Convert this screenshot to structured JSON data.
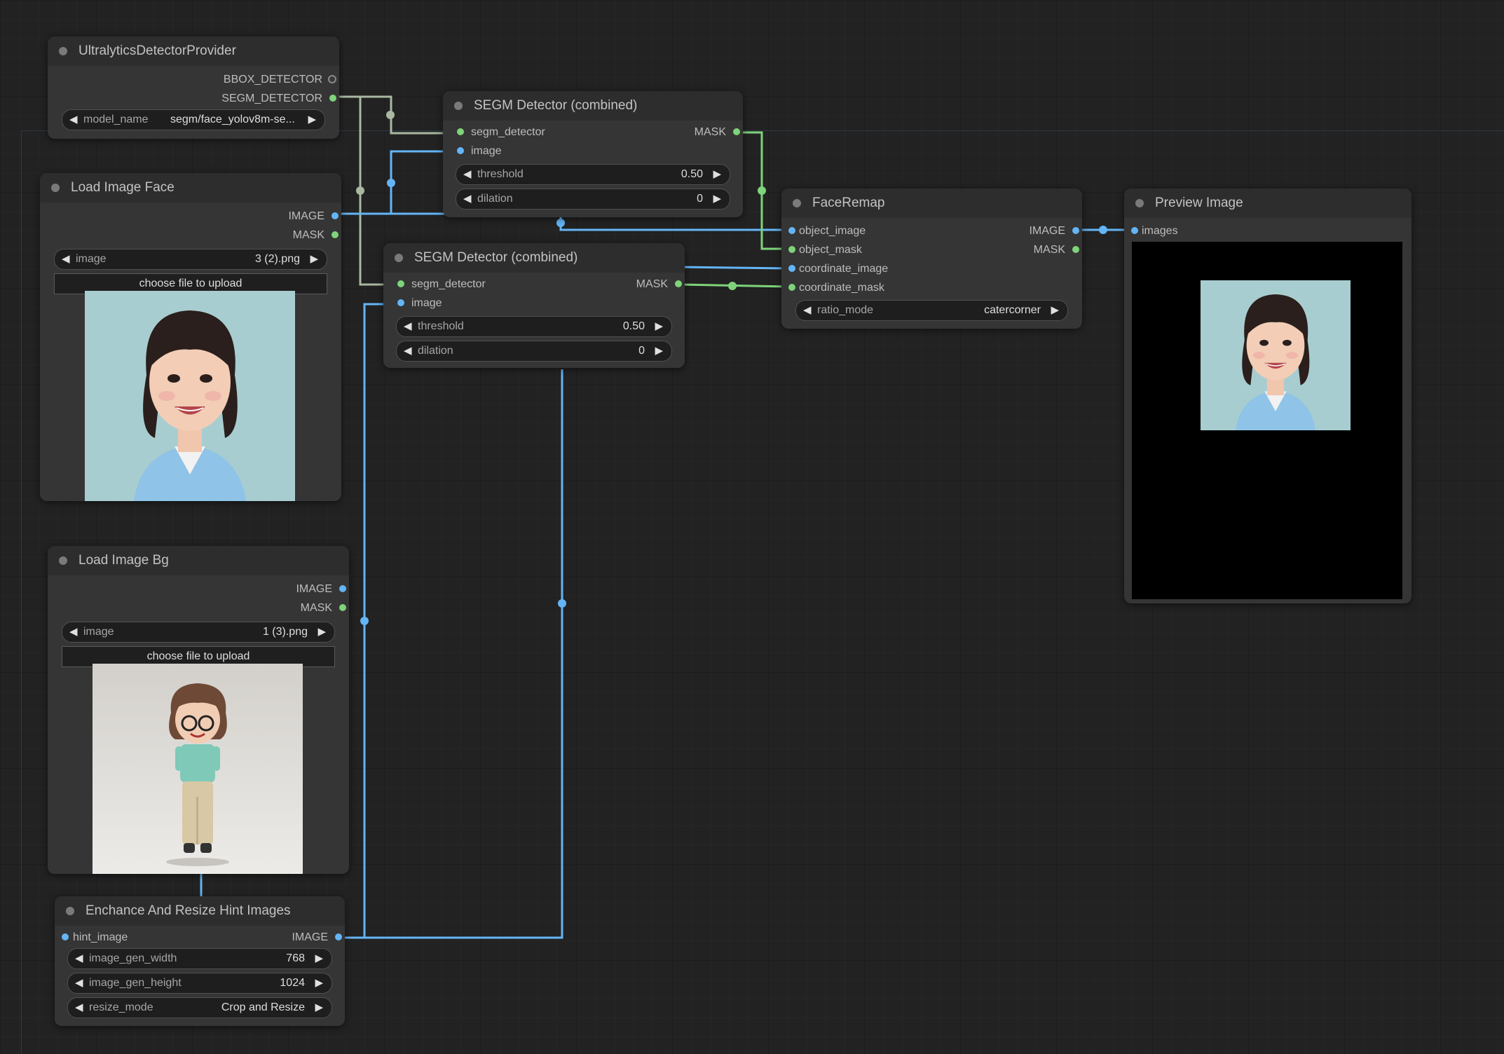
{
  "nodes": {
    "detector_provider": {
      "title": "UltralyticsDetectorProvider",
      "outputs": [
        "BBOX_DETECTOR",
        "SEGM_DETECTOR"
      ],
      "model_name": {
        "name": "model_name",
        "value": "segm/face_yolov8m-se..."
      }
    },
    "load_face": {
      "title": "Load Image Face",
      "outputs": [
        "IMAGE",
        "MASK"
      ],
      "image": {
        "name": "image",
        "value": "3 (2).png"
      },
      "upload_label": "choose file to upload"
    },
    "segm_top": {
      "title": "SEGM Detector (combined)",
      "inputs": [
        "segm_detector",
        "image"
      ],
      "output": "MASK",
      "threshold": {
        "name": "threshold",
        "value": "0.50"
      },
      "dilation": {
        "name": "dilation",
        "value": "0"
      }
    },
    "segm_bottom": {
      "title": "SEGM Detector (combined)",
      "inputs": [
        "segm_detector",
        "image"
      ],
      "output": "MASK",
      "threshold": {
        "name": "threshold",
        "value": "0.50"
      },
      "dilation": {
        "name": "dilation",
        "value": "0"
      }
    },
    "face_remap": {
      "title": "FaceRemap",
      "inputs": [
        "object_image",
        "object_mask",
        "coordinate_image",
        "coordinate_mask"
      ],
      "outputs": [
        "IMAGE",
        "MASK"
      ],
      "ratio_mode": {
        "name": "ratio_mode",
        "value": "catercorner"
      }
    },
    "preview": {
      "title": "Preview Image",
      "input": "images"
    },
    "load_bg": {
      "title": "Load Image Bg",
      "outputs": [
        "IMAGE",
        "MASK"
      ],
      "image": {
        "name": "image",
        "value": "1 (3).png"
      },
      "upload_label": "choose file to upload"
    },
    "enhance": {
      "title": "Enchance And Resize Hint Images",
      "input": "hint_image",
      "output": "IMAGE",
      "width": {
        "name": "image_gen_width",
        "value": "768"
      },
      "height": {
        "name": "image_gen_height",
        "value": "1024"
      },
      "resize_mode": {
        "name": "resize_mode",
        "value": "Crop and Resize"
      }
    }
  },
  "colors": {
    "image_link": "#64b5f6",
    "mask_link": "#7ed47a",
    "detector_link": "#a9b8a0",
    "node_bg": "#353535",
    "canvas_bg": "#222222"
  }
}
